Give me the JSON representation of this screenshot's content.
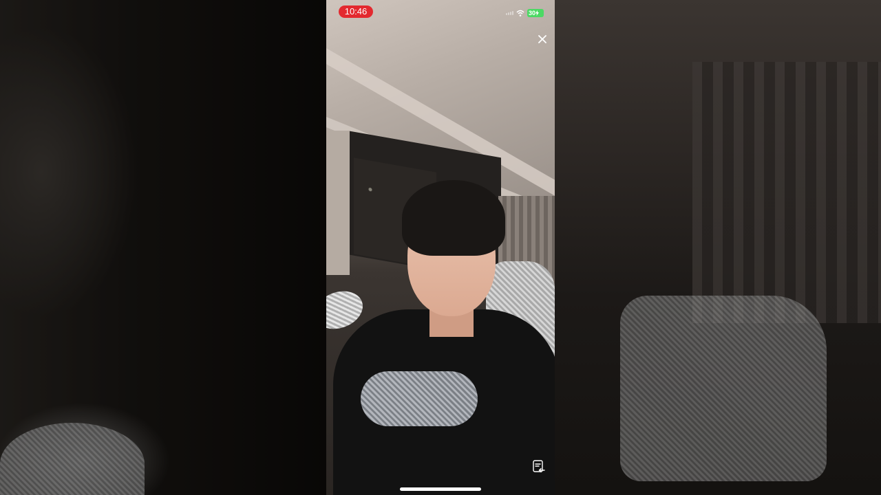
{
  "status_bar": {
    "time": "10:46",
    "battery": "30",
    "battery_color": "#4cd964",
    "recording_color": "#e3292f"
  },
  "controls": {
    "close_icon": "close-icon",
    "note_icon": "note-return-icon"
  }
}
